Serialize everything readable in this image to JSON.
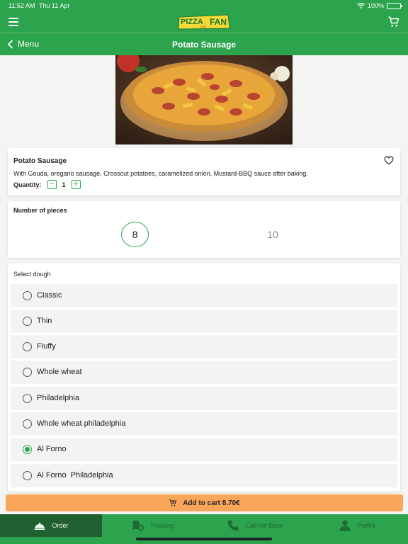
{
  "status_bar": {
    "time": "11:52 AM",
    "date": "Thu 11 Apr",
    "battery": "100%",
    "battery_level": 1.0
  },
  "app_bar": {
    "logo_text_1": "PIZZA",
    "logo_text_2": "FAN",
    "logo_small": "1998"
  },
  "nav": {
    "back_label": "Menu",
    "title": "Potato Sausage"
  },
  "product": {
    "name": "Potato Sausage",
    "description": "With Gouda, oregano sausage, Crosscut potatoes, caramelized onion, Mustard-BBQ sauce after baking.",
    "quantity_label": "Quantity:",
    "quantity_minus": "−",
    "quantity": "1",
    "quantity_plus": "+"
  },
  "pieces": {
    "title": "Number of pieces",
    "options": [
      "8",
      "10"
    ],
    "selected": "8"
  },
  "dough": {
    "title": "Select dough",
    "options": [
      "Classic",
      "Thin",
      "Fluffy",
      "Whole wheat",
      "Philadelphia",
      "Whole wheat philadelphia",
      "Al Forno",
      "Al Forno  Philadelphia"
    ],
    "selected": "Al Forno"
  },
  "add_to_cart": {
    "label": "Add to cart 8.70€"
  },
  "tabs": [
    {
      "label": "Order",
      "icon": "cloche-icon",
      "active": true
    },
    {
      "label": "Tracking",
      "icon": "tracking-icon",
      "active": false
    },
    {
      "label": "Call me Back",
      "icon": "phone-icon",
      "active": false
    },
    {
      "label": "Profile",
      "icon": "person-icon",
      "active": false
    }
  ],
  "colors": {
    "brand_green": "#2ca44e",
    "tab_active": "#1f5f30",
    "cart_orange": "#f9a65a",
    "logo_yellow": "#f6d935"
  }
}
